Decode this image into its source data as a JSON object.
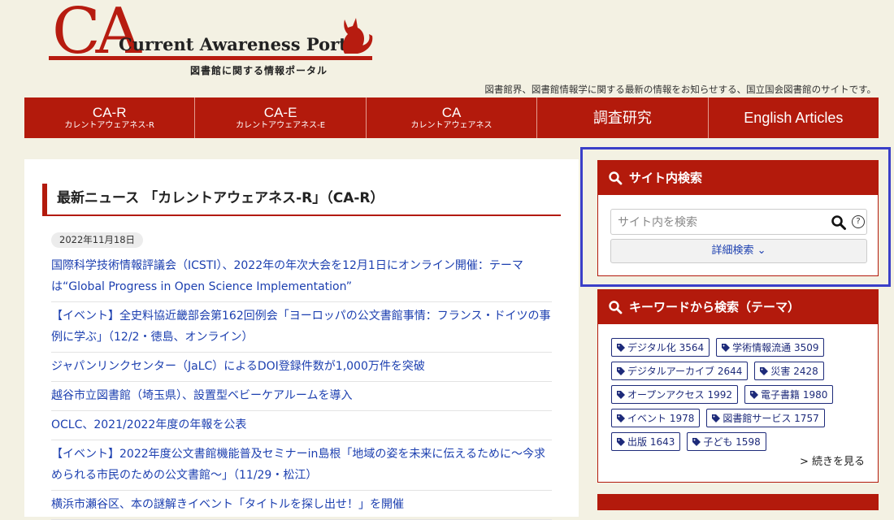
{
  "header": {
    "logo_letters": "CA",
    "logo_title": "Current Awareness Portal",
    "logo_subtitle": "図書館に関する情報ポータル",
    "tagline": "図書館界、図書館情報学に関する最新の情報をお知らせする、国立国会図書館のサイトです。"
  },
  "nav": {
    "items": [
      {
        "label": "CA-R",
        "sub": "カレントアウェアネス-R"
      },
      {
        "label": "CA-E",
        "sub": "カレントアウェアネス-E"
      },
      {
        "label": "CA",
        "sub": "カレントアウェアネス"
      },
      {
        "label": "調査研究",
        "sub": ""
      },
      {
        "label": "English Articles",
        "sub": ""
      }
    ]
  },
  "news": {
    "title": "最新ニュース 「カレントアウェアネス-R」（CA-R）",
    "date": "2022年11月18日",
    "items": [
      "国際科学技術情報評議会（ICSTI）、2022年の年次大会を12月1日にオンライン開催：テーマは“Global Progress in Open Science Implementation”",
      "【イベント】全史料協近畿部会第162回例会「ヨーロッパの公文書館事情：フランス・ドイツの事例に学ぶ」（12/2・徳島、オンライン）",
      "ジャパンリンクセンター（JaLC）によるDOI登録件数が1,000万件を突破",
      "越谷市立図書館（埼玉県）、設置型ベビーケアルームを導入",
      "OCLC、2021/2022年度の年報を公表",
      "【イベント】2022年度公文書館機能普及セミナーin島根「地域の姿を未来に伝えるために～今求められる市民のための公文書館～」（11/29・松江）",
      "横浜市瀬谷区、本の謎解きイベント「タイトルを探し出せ！」を開催"
    ]
  },
  "site_search": {
    "title": "サイト内検索",
    "placeholder": "サイト内を検索",
    "help": "?",
    "advanced_label": "詳細検索 ⌄"
  },
  "keyword_search": {
    "title": "キーワードから検索（テーマ）",
    "tags": [
      "デジタル化 3564",
      "学術情報流通 3509",
      "デジタルアーカイブ 2644",
      "災害 2428",
      "オープンアクセス 1992",
      "電子書籍 1980",
      "イベント 1978",
      "図書館サービス 1757",
      "出版 1643",
      "子ども 1598"
    ],
    "more": "> 続きを見る"
  },
  "colors": {
    "accent": "#b31a0c",
    "link": "#1d40b0",
    "background": "#f3f1e3",
    "highlight": "#3a3fc8"
  },
  "icons": [
    "cat-icon",
    "search-icon",
    "help-icon",
    "tag-icon"
  ]
}
